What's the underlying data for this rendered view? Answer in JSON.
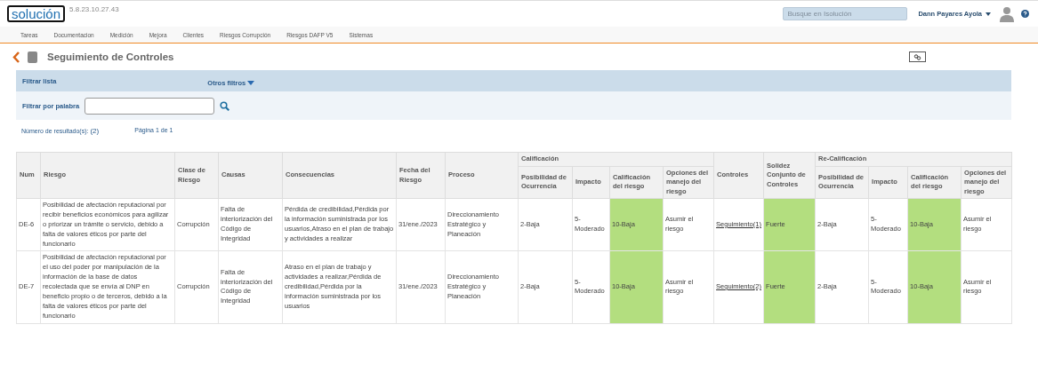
{
  "header": {
    "logo": "solución",
    "version": "5.8.23.10.27.43",
    "search": {
      "placeholder": "Busque en Isolución"
    },
    "user": "Dann Payares Ayola"
  },
  "nav": [
    "Tareas",
    "Documentacion",
    "Medición",
    "Mejora",
    "Clientes",
    "Riesgos Corrupción",
    "Riesgos DAFP V5",
    "Sistemas"
  ],
  "page_title": "Seguimiento de Controles",
  "filters": {
    "title": "Filtrar lista",
    "more": "Otros filtros",
    "word_label": "Filtrar por palabra"
  },
  "results": {
    "label": "Número de resultado(s):",
    "count": "(2)",
    "page": "Página 1 de 1"
  },
  "table": {
    "columns": [
      {
        "label": "Num"
      },
      {
        "label": "Riesgo"
      },
      {
        "label": "Clase de Riesgo"
      },
      {
        "label": "Causas"
      },
      {
        "label": "Consecuencias"
      },
      {
        "label": "Fecha del Riesgo"
      },
      {
        "label": "Proceso"
      },
      {
        "label": "Calificación",
        "colspan": 4,
        "children": [
          {
            "label": "Posibilidad de Ocurrencia"
          },
          {
            "label": "Impacto"
          },
          {
            "label": "Calificación del riesgo"
          },
          {
            "label": "Opciones del manejo del riesgo"
          }
        ]
      },
      {
        "label": "Controles"
      },
      {
        "label": "Solidez Conjunto de Controles"
      },
      {
        "label": "Re-Calificación",
        "colspan": 4,
        "children": [
          {
            "label": "Posibilidad de Ocurrencia"
          },
          {
            "label": "Impacto"
          },
          {
            "label": "Calificación del riesgo"
          },
          {
            "label": "Opciones del manejo del riesgo"
          }
        ]
      }
    ],
    "rows": [
      {
        "cells": [
          {
            "kind": "text",
            "text": "DE-6"
          },
          {
            "kind": "text",
            "text": "Posibilidad de afectación reputacional por recibir beneficios económicos para agilizar o priorizar un trámite o servicio, debido a falta de valores éticos por parte del funcionario"
          },
          {
            "kind": "text",
            "text": "Corrupción"
          },
          {
            "kind": "text",
            "text": "Falta de interiorización del Código de Integridad"
          },
          {
            "kind": "text",
            "text": "Pérdida de credibilidad,Pérdida por la información suministrada por los usuarios,Atraso en el plan de trabajo y actividades a realizar"
          },
          {
            "kind": "text",
            "text": "31/ene./2023"
          },
          {
            "kind": "text",
            "text": "Direccionamiento Estratégico y Planeación"
          },
          {
            "kind": "text",
            "text": "2-Baja"
          },
          {
            "kind": "text",
            "text": "5-Moderado"
          },
          {
            "kind": "text",
            "text": "10-Baja",
            "color": "#b3de7f"
          },
          {
            "kind": "text",
            "text": "Asumir el riesgo"
          },
          {
            "kind": "link",
            "text": "Seguimiento(1)"
          },
          {
            "kind": "text",
            "text": "Fuerte",
            "color": "#b3de7f"
          },
          {
            "kind": "text",
            "text": "2-Baja"
          },
          {
            "kind": "text",
            "text": "5-Moderado"
          },
          {
            "kind": "text",
            "text": "10-Baja",
            "color": "#b3de7f"
          },
          {
            "kind": "text",
            "text": "Asumir el riesgo"
          }
        ]
      },
      {
        "cells": [
          {
            "kind": "text",
            "text": "DE-7"
          },
          {
            "kind": "text",
            "text": "Posibilidad de afectación reputacional por el uso del poder por manipulación de la información de la base de datos recolectada que se envía al DNP en beneficio propio o de terceros, debido a la falta de valores éticos por parte del funcionario"
          },
          {
            "kind": "text",
            "text": "Corrupción"
          },
          {
            "kind": "text",
            "text": "Falta de interiorización del Código de Integridad"
          },
          {
            "kind": "text",
            "text": "Atraso en el plan de trabajo y actividades a realizar,Pérdida de credibilidad,Pérdida por la información suministrada por los usuarios"
          },
          {
            "kind": "text",
            "text": "31/ene./2023"
          },
          {
            "kind": "text",
            "text": "Direccionamiento Estratégico y Planeación"
          },
          {
            "kind": "text",
            "text": "2-Baja"
          },
          {
            "kind": "text",
            "text": "5-Moderado"
          },
          {
            "kind": "text",
            "text": "10-Baja",
            "color": "#b3de7f"
          },
          {
            "kind": "text",
            "text": "Asumir el riesgo"
          },
          {
            "kind": "link",
            "text": "Seguimiento(2)"
          },
          {
            "kind": "text",
            "text": "Fuerte",
            "color": "#b3de7f"
          },
          {
            "kind": "text",
            "text": "2-Baja"
          },
          {
            "kind": "text",
            "text": "5-Moderado"
          },
          {
            "kind": "text",
            "text": "10-Baja",
            "color": "#b3de7f"
          },
          {
            "kind": "text",
            "text": "Asumir el riesgo"
          }
        ]
      }
    ]
  }
}
